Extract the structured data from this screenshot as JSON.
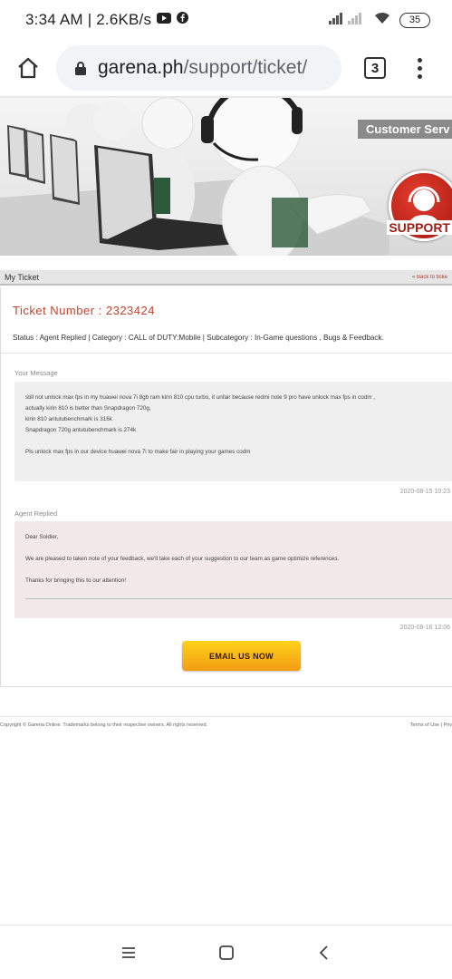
{
  "status_bar": {
    "time": "3:34 AM",
    "net_speed": "2.6KB/s",
    "battery": "35"
  },
  "browser": {
    "url_host": "garena.ph",
    "url_path": "/support/ticket/",
    "tab_count": "3"
  },
  "banner": {
    "customer_service_label": "Customer Serv",
    "support_label": "SUPPORT"
  },
  "ticket_bar": {
    "title": "My Ticket",
    "back_link": "« Back to ticke"
  },
  "ticket": {
    "number_label": "Ticket Number : 2323424",
    "status_line": "Status : Agent Replied | Category : CALL of DUTY:Mobile | Subcategory : In-Game questions , Bugs & Feedback.",
    "your_message_label": "Your Message",
    "user_message_lines": [
      "still not unlock max fps in my huawei nova 7i 8gb ram kirin 810 cpu turbo, it unfair because redmi note 9 pro have unlock max fps in codm ,",
      "actually kirin 810 is better than Snapdragon 720g,",
      "kirin 810 antutubenchmark is 316k",
      "Snapdragon 720g antutubenchmark is 274k",
      "Pls unlock max fps in our device huawei nova 7i to make fair in playing your games codm"
    ],
    "user_timestamp": "2020-08-15 10:23",
    "agent_replied_label": "Agent Replied",
    "agent_message_lines": [
      "Dear Soldier,",
      "We are pleased to taken note of your feedback, we'll take each of your suggestion to our team as game optimize references.",
      "Thanks for bringing this to our attention!"
    ],
    "agent_timestamp": "2020-08-16 12:06",
    "email_button": "EMAIL US NOW"
  },
  "footer": {
    "copyright": "Copyright © Garena Online. Trademarks belong to their respective owners. All rights reserved.",
    "links": "Terms of Use | Priv"
  },
  "colors": {
    "accent": "#c0432f",
    "button_gradient_top": "#ffd21a",
    "button_gradient_bottom": "#f39c12"
  }
}
